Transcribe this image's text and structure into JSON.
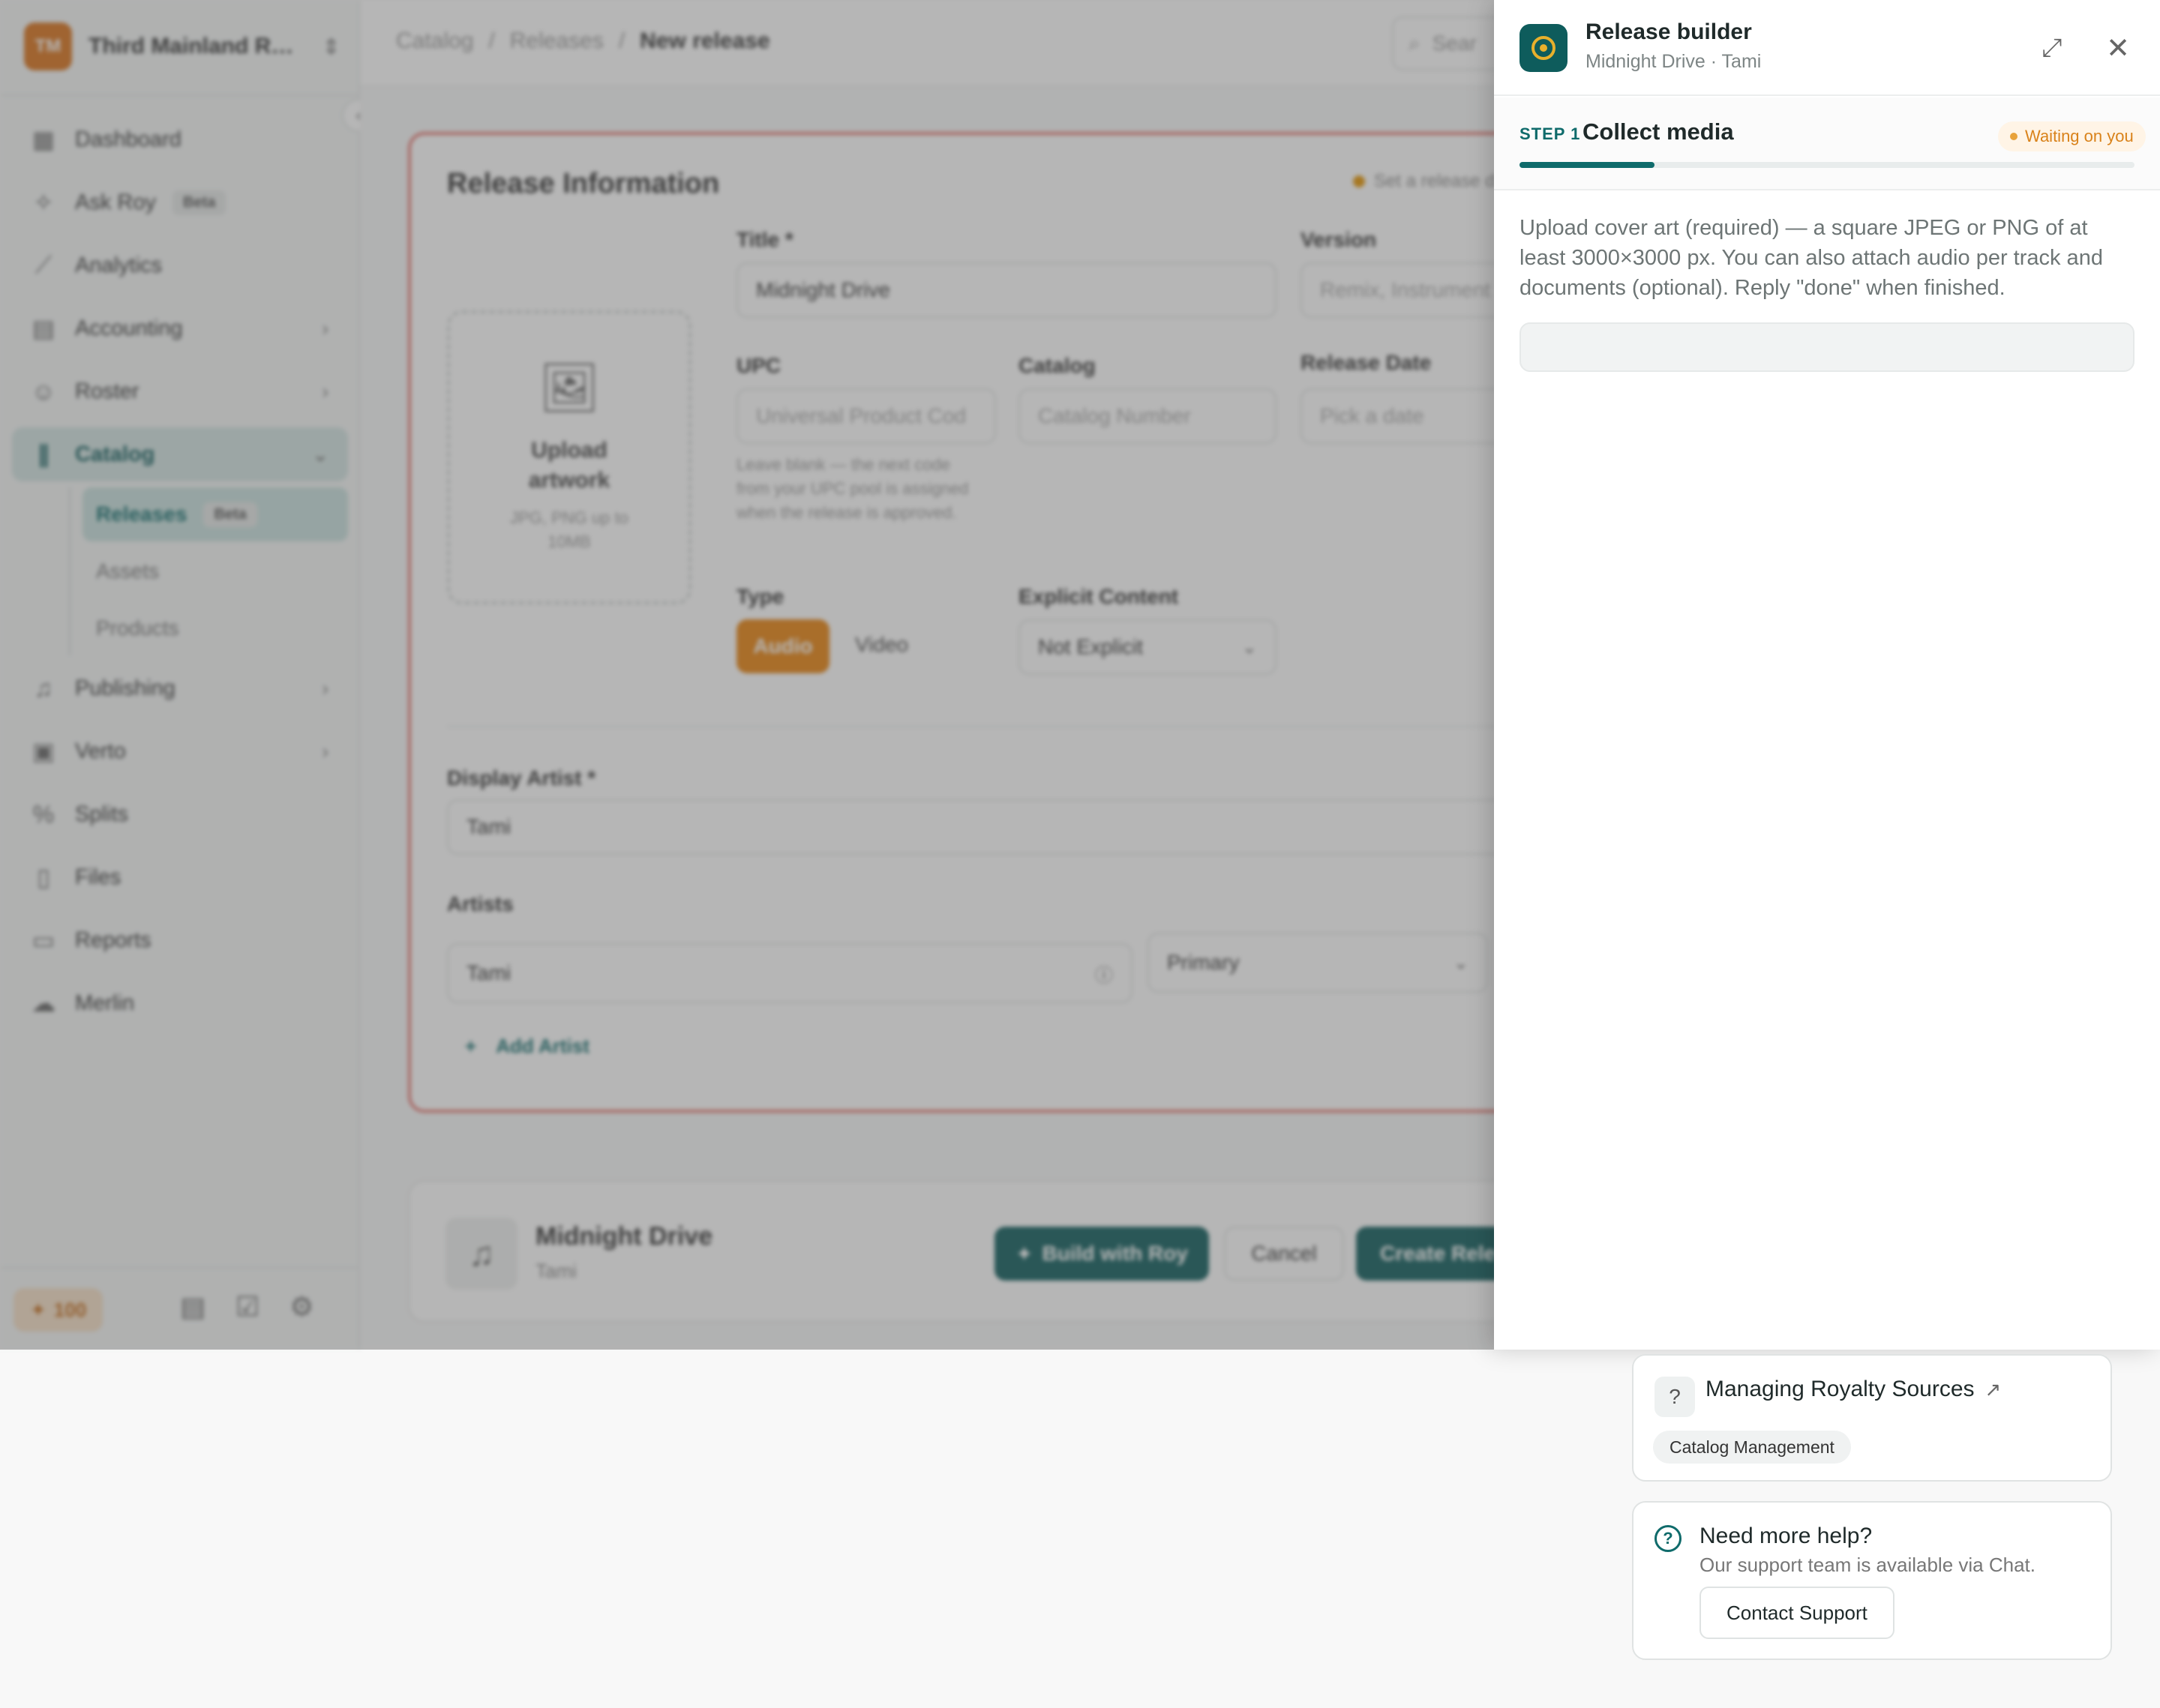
{
  "org": {
    "initials": "TM",
    "name": "Third Mainland Reco..."
  },
  "sidebar": {
    "items": [
      {
        "label": "Dashboard"
      },
      {
        "label": "Ask Roy",
        "badge": "Beta"
      },
      {
        "label": "Analytics"
      },
      {
        "label": "Accounting"
      },
      {
        "label": "Roster"
      },
      {
        "label": "Catalog"
      },
      {
        "label": "Publishing"
      },
      {
        "label": "Verto"
      },
      {
        "label": "Splits"
      },
      {
        "label": "Files"
      },
      {
        "label": "Reports"
      },
      {
        "label": "Merlin"
      }
    ],
    "catalog_sub": [
      {
        "label": "Releases",
        "badge": "Beta"
      },
      {
        "label": "Assets"
      },
      {
        "label": "Products"
      }
    ],
    "credits": "100"
  },
  "breadcrumb": {
    "b1": "Catalog",
    "sep": "/",
    "b2": "Releases",
    "current": "New release"
  },
  "search": {
    "placeholder": "Sear"
  },
  "form": {
    "title": "Release Information",
    "hint": "Set a release d",
    "upload_label": "Upload artwork",
    "upload_sub": "JPG, PNG up to 10MB",
    "title_label": "Title *",
    "title_value": "Midnight Drive",
    "version_label": "Version",
    "version_placeholder": "Remix, Instrument",
    "upc_label": "UPC",
    "upc_placeholder": "Universal Product Cod",
    "upc_help": "Leave blank — the next code from your UPC pool is assigned when the release is approved.",
    "catalog_label": "Catalog",
    "catalog_placeholder": "Catalog Number",
    "release_date_label": "Release Date",
    "release_date_placeholder": "Pick a date",
    "type_label": "Type",
    "type_audio": "Audio",
    "type_video": "Video",
    "explicit_label": "Explicit Content",
    "explicit_value": "Not Explicit",
    "display_artist_label": "Display Artist *",
    "display_artist_value": "Tami",
    "artists_label": "Artists",
    "artist_value": "Tami",
    "artist_role": "Primary",
    "add_artist": "Add Artist"
  },
  "bottom_bar": {
    "title": "Midnight Drive",
    "artist": "Tami",
    "build_label": "Build with Roy",
    "cancel_label": "Cancel",
    "create_label": "Create Rele"
  },
  "drawer": {
    "title": "Release builder",
    "subtitle": "Midnight Drive · Tami",
    "step_num": "STEP 1",
    "step_name": "Collect media",
    "status": "Waiting on you",
    "progress": 0.22,
    "message": "Upload cover art (required) — a square JPEG or PNG of at least 3000×3000 px. You can also attach audio per track and documents (optional). Reply \"done\" when finished.",
    "input_value": ""
  },
  "help": {
    "article_title": "Managing Royalty Sources",
    "article_tag": "Catalog Management",
    "more_title": "Need more help?",
    "more_sub": "Our support team is available via Chat.",
    "contact_label": "Contact Support"
  },
  "colors": {
    "accent": "#0e5c5c",
    "audio": "#e8830f",
    "error_border": "#e5766f",
    "warning": "#d9821a"
  }
}
